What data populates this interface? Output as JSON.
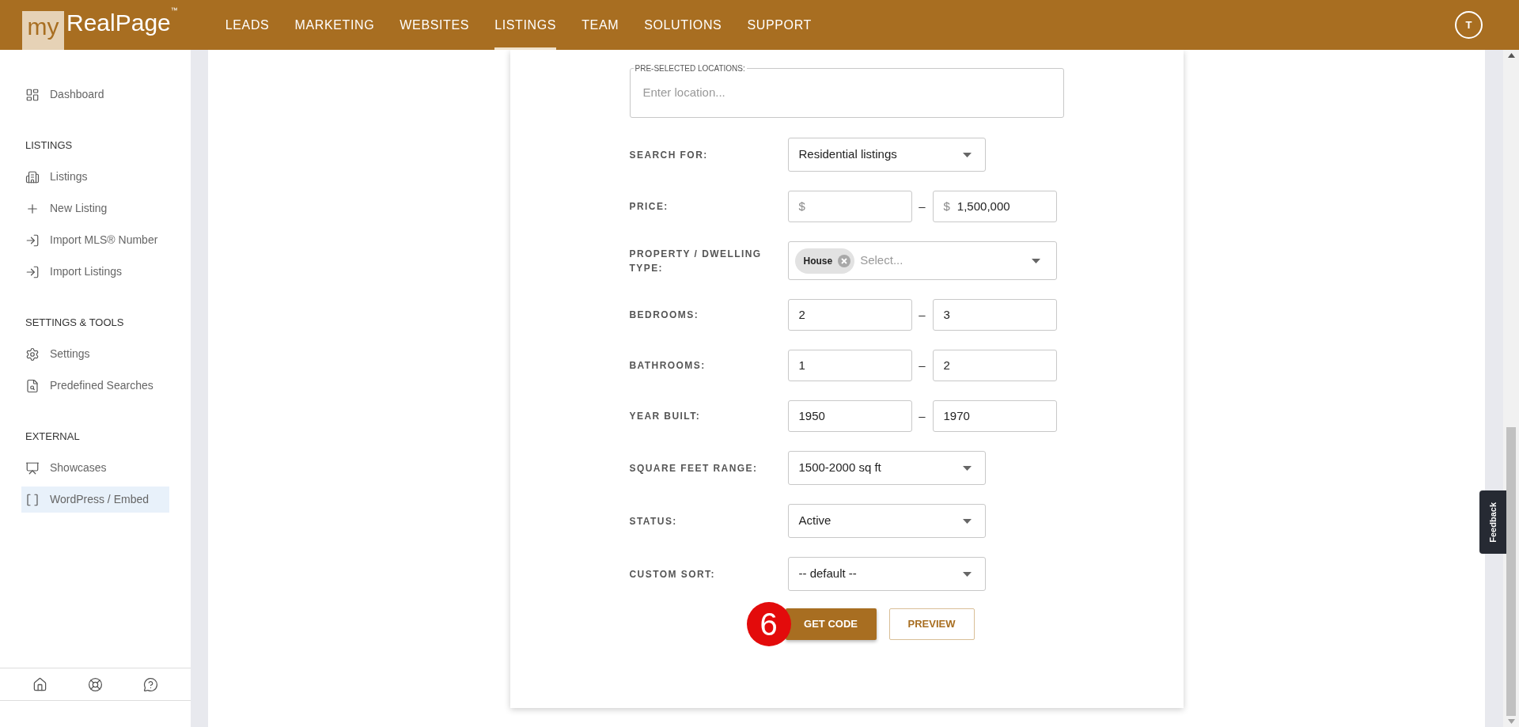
{
  "header": {
    "logo": {
      "prefix": "my",
      "name": "RealPage",
      "mark": "™"
    },
    "nav": [
      {
        "label": "LEADS",
        "selected": false
      },
      {
        "label": "MARKETING",
        "selected": false
      },
      {
        "label": "WEBSITES",
        "selected": false
      },
      {
        "label": "LISTINGS",
        "selected": true
      },
      {
        "label": "TEAM",
        "selected": false
      },
      {
        "label": "SOLUTIONS",
        "selected": false
      },
      {
        "label": "SUPPORT",
        "selected": false
      }
    ],
    "avatar": "T"
  },
  "sidebar": {
    "sections": [
      {
        "items": [
          {
            "label": "Dashboard",
            "selected": false
          }
        ]
      },
      {
        "heading": "LISTINGS",
        "items": [
          {
            "label": "Listings",
            "selected": false
          },
          {
            "label": "New Listing",
            "selected": false
          },
          {
            "label": "Import MLS® Number",
            "selected": false
          },
          {
            "label": "Import Listings",
            "selected": false
          }
        ]
      },
      {
        "heading": "SETTINGS & TOOLS",
        "items": [
          {
            "label": "Settings",
            "selected": false
          },
          {
            "label": "Predefined Searches",
            "selected": false
          }
        ]
      },
      {
        "heading": "EXTERNAL",
        "items": [
          {
            "label": "Showcases",
            "selected": false
          },
          {
            "label": "WordPress / Embed",
            "selected": true
          }
        ]
      }
    ]
  },
  "form": {
    "location": {
      "label": "PRE-SELECTED LOCATIONS:",
      "placeholder": "Enter location..."
    },
    "rows": [
      {
        "kind": "select",
        "label": "SEARCH FOR:",
        "value": "Residential listings"
      },
      {
        "kind": "range",
        "label": "PRICE:",
        "from": {
          "prefix": "$"
        },
        "separator": "–",
        "to": {
          "prefix": "$",
          "value": "1,500,000"
        }
      },
      {
        "kind": "multiselect",
        "label": "PROPERTY / DWELLING TYPE:",
        "tags": [
          {
            "label": "House"
          }
        ],
        "placeholder": "Select..."
      },
      {
        "kind": "range",
        "label": "BEDROOMS:",
        "from": {
          "value": "2"
        },
        "separator": "–",
        "to": {
          "value": "3"
        }
      },
      {
        "kind": "range",
        "label": "BATHROOMS:",
        "from": {
          "value": "1"
        },
        "separator": "–",
        "to": {
          "value": "2"
        }
      },
      {
        "kind": "range",
        "label": "YEAR BUILT:",
        "from": {
          "value": "1950"
        },
        "separator": "–",
        "to": {
          "value": "1970"
        }
      },
      {
        "kind": "select",
        "label": "SQUARE FEET RANGE:",
        "value": "1500-2000 sq ft"
      },
      {
        "kind": "select",
        "label": "STATUS:",
        "value": "Active"
      },
      {
        "kind": "select",
        "label": "CUSTOM SORT:",
        "value": "-- default --"
      }
    ],
    "step_badge": "6",
    "buttons": [
      {
        "kind": "primary",
        "label": "GET CODE"
      },
      {
        "kind": "secondary",
        "label": "PREVIEW"
      }
    ]
  },
  "feedback": "Feedback"
}
